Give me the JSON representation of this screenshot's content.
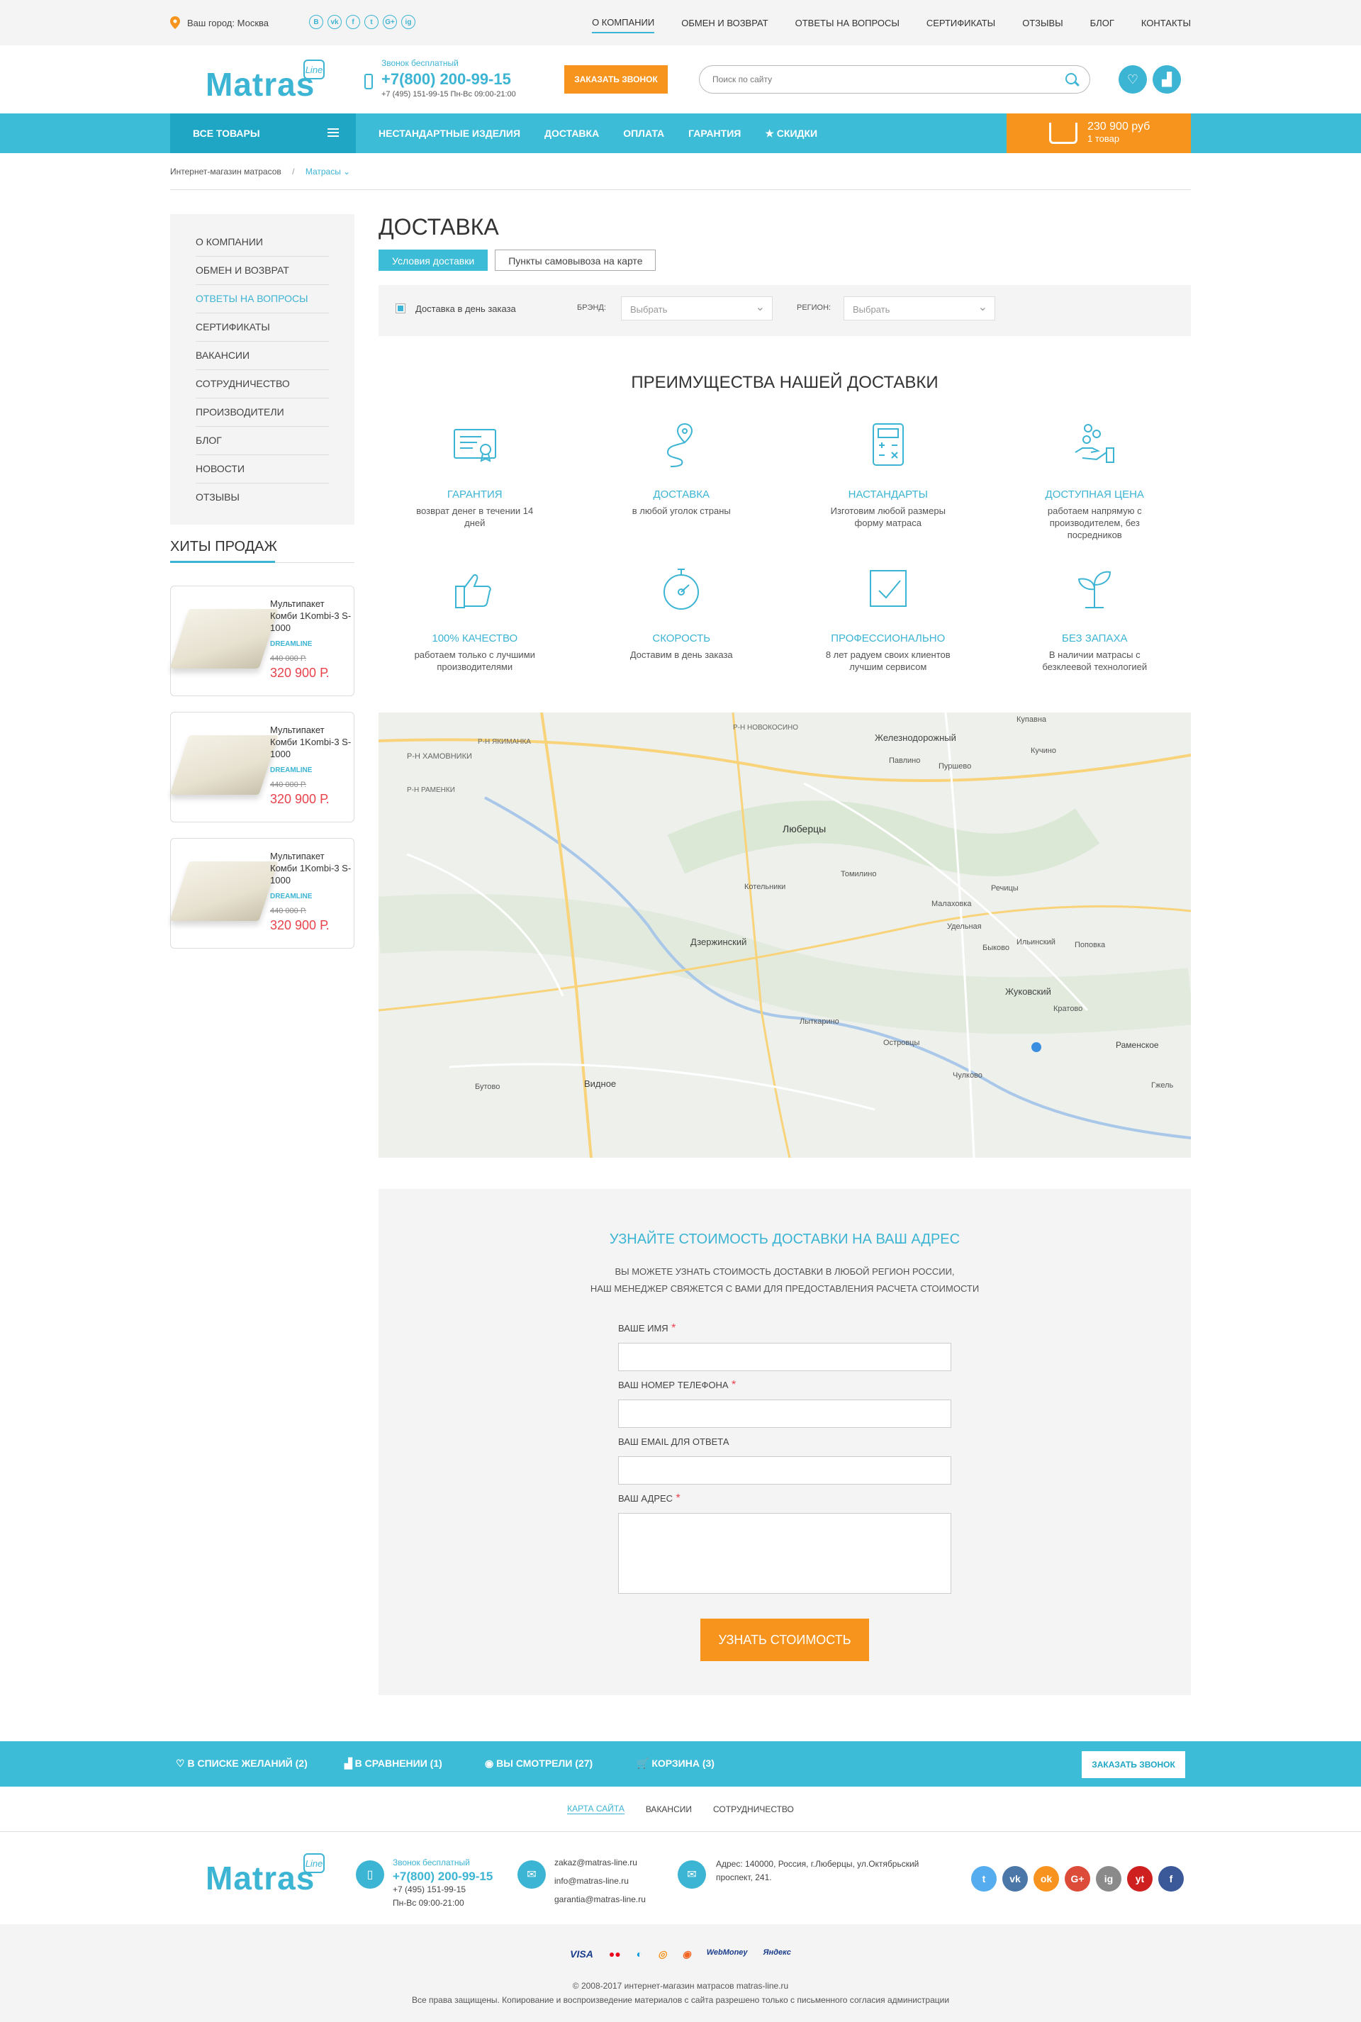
{
  "topbar": {
    "city": "Ваш город: Москва",
    "socials": [
      "В",
      "vk",
      "f",
      "t",
      "G+",
      "ig"
    ],
    "nav": [
      "О компании",
      "Обмен и возврат",
      "Ответы на вопросы",
      "Сертификаты",
      "Отзывы",
      "Блог",
      "Контакты"
    ]
  },
  "header": {
    "logo": "Matras",
    "logo_badge": "Line",
    "free_call": "Звонок бесплатный",
    "phone": "+7(800) 200-99-15",
    "phone2": "+7 (495) 151-99-15  Пн-Вс 09:00-21:00",
    "call_button": "Заказать звонок",
    "search_placeholder": "Поиск по сайту"
  },
  "mainnav": {
    "all": "Все товары",
    "links": [
      "Нестандартные изделия",
      "Доставка",
      "Оплата",
      "Гарантия",
      "★ Скидки"
    ],
    "cart_sum": "230 900 руб",
    "cart_count": "1 товар"
  },
  "breadcrumbs": [
    "Интернет-магазин матрасов",
    "/",
    "Матрасы ⌄"
  ],
  "sidebar": {
    "menu": [
      "О компании",
      "Обмен и возврат",
      "Ответы на вопросы",
      "Сертификаты",
      "Вакансии",
      "Сотрудничество",
      "Производители",
      "Блог",
      "Новости",
      "Отзывы"
    ],
    "hits_title": "Хиты продаж",
    "products": [
      {
        "name": "Мультипакет Комби 1Kombi-3 S-1000",
        "brand": "DREAMLINE",
        "old": "440 000 Р.",
        "price": "320 900 Р."
      },
      {
        "name": "Мультипакет Комби 1Kombi-3 S-1000",
        "brand": "DREAMLINE",
        "old": "440 000 Р.",
        "price": "320 900 Р."
      },
      {
        "name": "Мультипакет Комби 1Kombi-3 S-1000",
        "brand": "DREAMLINE",
        "old": "440 000 Р.",
        "price": "320 900 Р."
      }
    ]
  },
  "page": {
    "title": "Доставка",
    "tabs": [
      "Условия доставки",
      "Пункты самовывоза на карте"
    ],
    "filter_check": "Доставка в день заказа",
    "brand_label": "Брэнд:",
    "brand_value": "Выбрать",
    "region_label": "Регион:",
    "region_value": "Выбрать"
  },
  "advantages": {
    "title": "Преимущества нашей доставки",
    "items": [
      {
        "icon": "certificate-icon",
        "title": "Гарантия",
        "text": "возврат денег в течении 14 дней"
      },
      {
        "icon": "route-pin-icon",
        "title": "Доставка",
        "text": "в любой уголок страны"
      },
      {
        "icon": "calculator-icon",
        "title": "Настандарты",
        "text": "Изготовим любой размеры форму матраса"
      },
      {
        "icon": "hand-coins-icon",
        "title": "Доступная цена",
        "text": "работаем напрямую с производителем, без посредников"
      },
      {
        "icon": "thumbs-up-icon",
        "title": "100% качество",
        "text": "работаем только с лучшими производителями"
      },
      {
        "icon": "stopwatch-icon",
        "title": "Скорость",
        "text": "Доставим в день заказа"
      },
      {
        "icon": "checkbox-icon",
        "title": "Профессионально",
        "text": "8 лет радуем своих клиентов лучшим сервисом"
      },
      {
        "icon": "sprout-icon",
        "title": "Без запаха",
        "text": "В наличии матрасы с безклеевой технологией"
      }
    ]
  },
  "map": {
    "labels": [
      "Р-Н ХАМОВНИКИ",
      "Р-Н ЯКИМАНКА",
      "Р-Н РАМЕНКИ",
      "Р-Н НОВОКОСИНО",
      "Железнодорожный",
      "Купавна",
      "Павлино",
      "Кучино",
      "Пуршево",
      "Люберцы",
      "Котельники",
      "Томилино",
      "Малаховка",
      "Дзержинский",
      "Жуковский",
      "Раменское",
      "Видное",
      "Бутово",
      "Лыткарино",
      "Островцы",
      "Кратово",
      "Быково",
      "Ильинский",
      "Удельная",
      "Речицы",
      "Поповка",
      "Чулково",
      "Гжель"
    ]
  },
  "form": {
    "title": "Узнайте стоимость доставки на ваш адрес",
    "sub1": "Вы можете узнать стоимость доставки в любой регион России,",
    "sub2": "наш менеджер свяжется с вами для предоставления расчета стоимости",
    "name_label": "Ваше имя",
    "phone_label": "Ваш номер телефона",
    "email_label": "Ваш email для ответа",
    "address_label": "Ваш адрес",
    "required": "*",
    "submit": "Узнать стоимость"
  },
  "bottombar": {
    "wishlist": "В списке желаний (2)",
    "compare": "В сравнении (1)",
    "viewed": "Вы смотрели (27)",
    "cart": "Корзина (3)",
    "call": "Заказать звонок"
  },
  "footlinks": [
    "Карта сайта",
    "Вакансии",
    "Сотрудничество"
  ],
  "footer": {
    "free_call": "Звонок бесплатный",
    "phone": "+7(800) 200-99-15",
    "phone2": "+7 (495) 151-99-15",
    "hours": "Пн-Вс 09:00-21:00",
    "emails": [
      "zakaz@matras-line.ru",
      "info@matras-line.ru",
      "garantia@matras-line.ru"
    ],
    "address": "Адрес: 140000, Россия, г.Люберцы, ул.Октябрьский проспект, 241.",
    "socials": [
      {
        "name": "twitter-icon",
        "letter": "t",
        "color": "#55acee"
      },
      {
        "name": "vk-icon",
        "letter": "vk",
        "color": "#4a76a8"
      },
      {
        "name": "odnoklassniki-icon",
        "letter": "ok",
        "color": "#f7931e"
      },
      {
        "name": "google-plus-icon",
        "letter": "G+",
        "color": "#dd4b39"
      },
      {
        "name": "instagram-icon",
        "letter": "ig",
        "color": "#8a8a8a"
      },
      {
        "name": "youtube-icon",
        "letter": "yt",
        "color": "#cd201f"
      },
      {
        "name": "facebook-icon",
        "letter": "f",
        "color": "#3b5998"
      }
    ]
  },
  "copyright": {
    "payments": [
      "VISA",
      "●●",
      "◐",
      "◎",
      "◉",
      "WebMoney",
      "Яндекс"
    ],
    "line1": "© 2008-2017 интернет-магазин матрасов matras-line.ru",
    "line2": "Все права защищены. Копирование и воспроизведение материалов с сайта разрешено только с письменного согласия администрации"
  },
  "colors": {
    "accent": "#3cb4d3",
    "nav": "#3cbcd6",
    "orange": "#f7941d",
    "price": "#e8424d"
  }
}
